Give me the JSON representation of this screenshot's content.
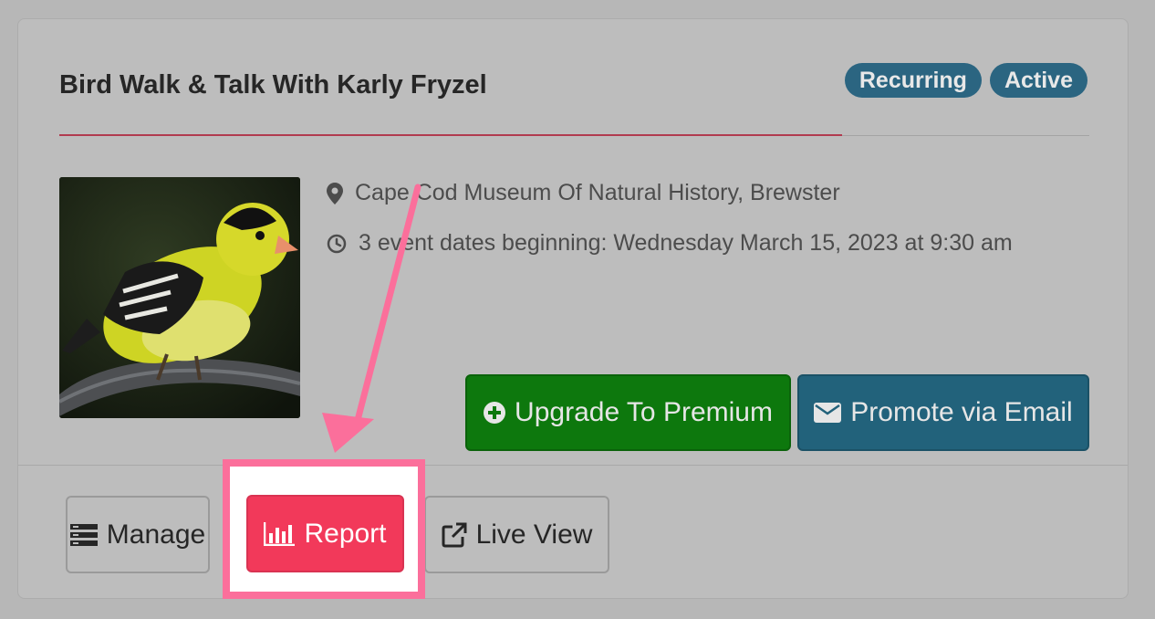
{
  "event": {
    "title": "Bird Walk & Talk With Karly Fryzel",
    "badges": [
      "Recurring",
      "Active"
    ],
    "location": "Cape Cod Museum Of Natural History, Brewster",
    "dates": "3 event dates beginning: Wednesday March 15, 2023 at 9:30 am",
    "image_subject": "goldfinch-on-perch"
  },
  "actions": {
    "upgrade_label": "Upgrade To Premium",
    "promote_label": "Promote via Email"
  },
  "footer": {
    "manage_label": "Manage",
    "report_label": "Report",
    "live_view_label": "Live View"
  },
  "icons": {
    "location": "map-marker-icon",
    "time": "clock-icon",
    "upgrade": "plus-circle-icon",
    "promote": "envelope-icon",
    "manage": "list-icon",
    "report": "bar-chart-icon",
    "live_view": "external-link-icon"
  },
  "colors": {
    "badge": "#2b6581",
    "upgrade": "#0d780d",
    "promote": "#22627b",
    "report": "#f2395a",
    "highlight": "#fb6f9b",
    "title_rule": "#b13b4f"
  }
}
